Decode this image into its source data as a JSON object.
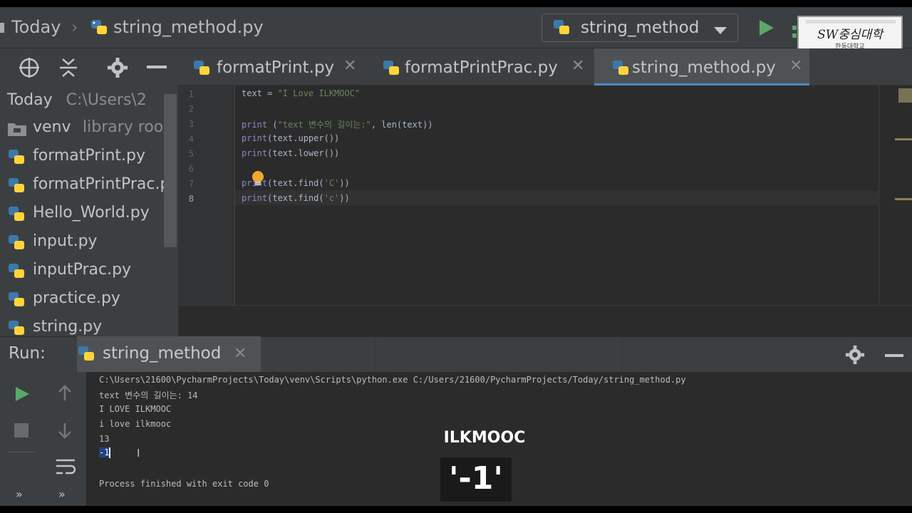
{
  "navbar": {
    "project": "Today",
    "file": "string_method.py",
    "run_config": "string_method",
    "logo_text": "SW중심대학",
    "logo_subtext": "한동대학교"
  },
  "project_panel": {
    "root_name": "Today",
    "root_path": "C:\\Users\\2",
    "items": [
      {
        "name": "venv",
        "note": "library root",
        "type": "folder"
      },
      {
        "name": "formatPrint.py",
        "type": "file"
      },
      {
        "name": "formatPrintPrac.p",
        "type": "file"
      },
      {
        "name": "Hello_World.py",
        "type": "file"
      },
      {
        "name": "input.py",
        "type": "file"
      },
      {
        "name": "inputPrac.py",
        "type": "file"
      },
      {
        "name": "practice.py",
        "type": "file"
      },
      {
        "name": "string.py",
        "type": "file"
      }
    ]
  },
  "tabs": [
    {
      "label": "formatPrint.py",
      "active": false
    },
    {
      "label": "formatPrintPrac.py",
      "active": false
    },
    {
      "label": "string_method.py",
      "active": true
    }
  ],
  "editor": {
    "line_numbers": [
      "1",
      "2",
      "3",
      "4",
      "5",
      "6",
      "7",
      "8"
    ],
    "lines": [
      {
        "a": "text = ",
        "s": "\"I Love ILKMOOC\"",
        "b": ""
      },
      {
        "a": "",
        "s": "",
        "b": ""
      },
      {
        "p": "print",
        "a": " (",
        "s": "\"text 변수의 길이는:\"",
        "b": ", len(text))"
      },
      {
        "p": "print",
        "a": "(text.upper())",
        "s": "",
        "b": ""
      },
      {
        "p": "print",
        "a": "(text.lower())",
        "s": "",
        "b": ""
      },
      {
        "a": "",
        "s": "",
        "b": ""
      },
      {
        "p": "print",
        "a": "(text.find(",
        "s": "'C'",
        "b": "))"
      },
      {
        "p": "print",
        "a": "(text.find(",
        "s": "'c'",
        "b": "))"
      }
    ]
  },
  "run_panel": {
    "label": "Run:",
    "tab": "string_method",
    "console": [
      "C:\\Users\\21600\\PycharmProjects\\Today\\venv\\Scripts\\python.exe C:/Users/21600/PycharmProjects/Today/string_method.py",
      "text 변수의 길이는: 14",
      "I LOVE ILKMOOC",
      "i love ilkmooc",
      "13",
      "-1",
      "",
      "Process finished with exit code 0"
    ]
  },
  "caption": {
    "top": "ILKMOOC",
    "bottom": "'-1'"
  },
  "colors": {
    "accent": "#4a88c7",
    "run_green": "#59a869",
    "bulb": "#f0a732"
  }
}
